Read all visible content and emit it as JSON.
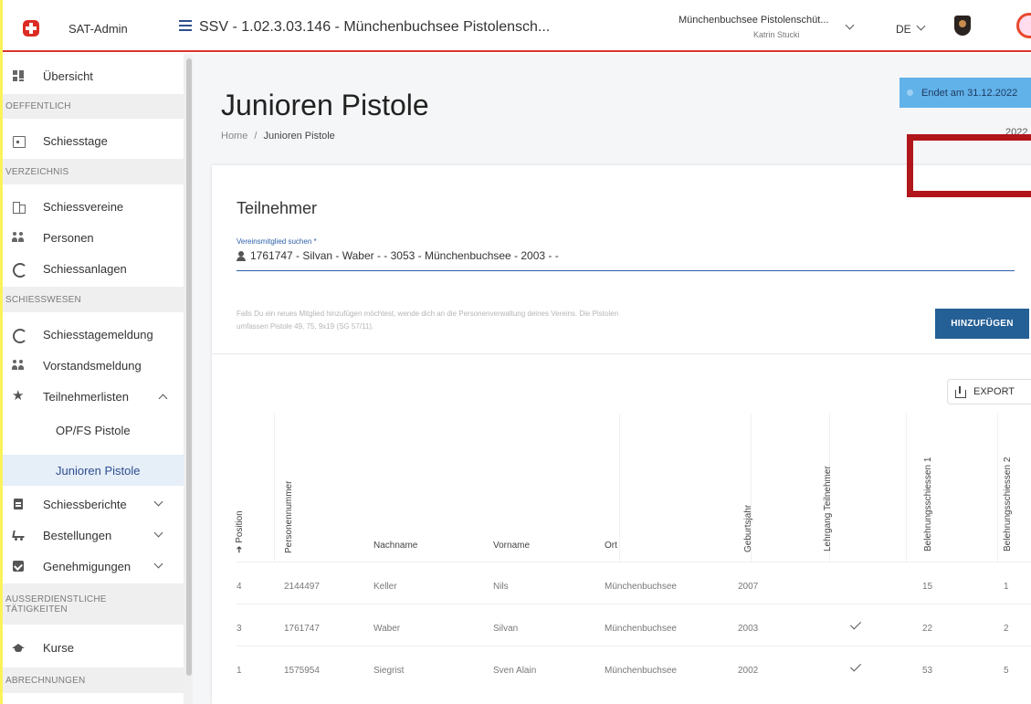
{
  "topbar": {
    "app_name": "SAT-Admin",
    "title": "SSV - 1.02.3.03.146 - Münchenbuchsee Pistolensch...",
    "org": "Münchenbuchsee Pistolenschüt...",
    "user": "Katrin Stucki",
    "language": "DE"
  },
  "sidebar": {
    "overview": "Übersicht",
    "section_public": "OEFFENTLICH",
    "schiesstage": "Schiesstage",
    "section_directory": "VERZEICHNIS",
    "schiessvereine": "Schiessvereine",
    "personen": "Personen",
    "schiessanlagen": "Schiessanlagen",
    "section_shooting": "SCHIESSWESEN",
    "schiesstagemeldung": "Schiesstagemeldung",
    "vorstandsmeldung": "Vorstandsmeldung",
    "teilnehmerlisten": "Teilnehmerlisten",
    "opfs_pistole": "OP/FS Pistole",
    "junioren_pistole": "Junioren Pistole",
    "schiessberichte": "Schiessberichte",
    "bestellungen": "Bestellungen",
    "genehmigungen": "Genehmigungen",
    "section_extra_1": "AUSSERDIENSTLICHE",
    "section_extra_2": "TÄTIGKEITEN",
    "kurse": "Kurse",
    "section_billing": "ABRECHNUNGEN"
  },
  "main": {
    "title": "Junioren Pistole",
    "crumb_home": "Home",
    "crumb_sep": "/",
    "crumb_current": "Junioren Pistole",
    "ends_badge": "Endet am 31.12.2022",
    "year": "2022",
    "card_title": "Teilnehmer",
    "search_label": "Vereinsmitglied suchen *",
    "search_value": "1761747 - Silvan - Waber - - 3053 - Münchenbuchsee - 2003 - -",
    "hint_line1": "Falls Du ein neues Mitglied hinzufügen möchtest, wende dich an die Personenverwaltung deines Vereins. Die Pistolen",
    "hint_line2": "umfassen Pistole 49, 75, 9x19 (SG 57/11).",
    "add_button": "HINZUFÜGEN",
    "export_button": "EXPORT"
  },
  "table": {
    "headers": {
      "position": "Position",
      "personennummer": "Personennummer",
      "nachname": "Nachname",
      "vorname": "Vorname",
      "ort": "Ort",
      "geburtsjahr": "Geburtsjahr",
      "lehrgang": "Lehrgang Teilnehmer",
      "beleh1": "Belehrungsschiessen 1",
      "beleh2": "Belehrungsschiessen 2"
    },
    "rows": [
      {
        "position": "4",
        "personennummer": "2144497",
        "nachname": "Keller",
        "vorname": "Nils",
        "ort": "Münchenbuchsee",
        "geburtsjahr": "2007",
        "lehrgang": false,
        "beleh1": "15",
        "beleh2": "1"
      },
      {
        "position": "3",
        "personennummer": "1761747",
        "nachname": "Waber",
        "vorname": "Silvan",
        "ort": "Münchenbuchsee",
        "geburtsjahr": "2003",
        "lehrgang": true,
        "beleh1": "22",
        "beleh2": "2"
      },
      {
        "position": "1",
        "personennummer": "1575954",
        "nachname": "Siegrist",
        "vorname": "Sven Alain",
        "ort": "Münchenbuchsee",
        "geburtsjahr": "2002",
        "lehrgang": true,
        "beleh1": "53",
        "beleh2": "5"
      }
    ]
  },
  "colors": {
    "accent": "#245f95",
    "brand_red": "#dc2c23",
    "badge_blue": "#62b2ea",
    "highlight_frame": "#b0161a",
    "outer_background": "#fbf25a"
  }
}
